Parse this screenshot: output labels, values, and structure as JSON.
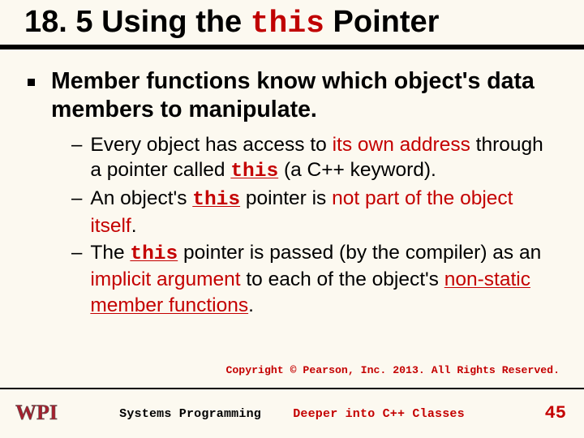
{
  "title": {
    "pre": "18. 5 Using the ",
    "keyword": "this",
    "post": " Pointer"
  },
  "lead": "Member functions know which object's data members to manipulate.",
  "sub1": {
    "a": "Every object has access to ",
    "b": "its own address",
    "c": " through a pointer called ",
    "kw": "this",
    "d": " (a C++ keyword)."
  },
  "sub2": {
    "a": "An object's ",
    "kw": "this",
    "b": " pointer is ",
    "c": "not part of the object itself",
    "d": "."
  },
  "sub3": {
    "a": "The ",
    "kw": "this",
    "b": " pointer is passed (by the compiler) as an ",
    "c": "implicit argument",
    "d": " to each of the object's ",
    "e": "non-static member functions",
    "f": "."
  },
  "copyright": "Copyright © Pearson, Inc. 2013. All Rights Reserved.",
  "footer": {
    "left": "Systems Programming",
    "right": "Deeper into C++ Classes"
  },
  "pagenum": "45"
}
